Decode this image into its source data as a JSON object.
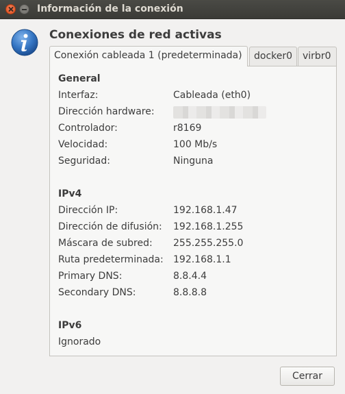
{
  "window": {
    "title": "Información de la conexión"
  },
  "heading": "Conexiones de red activas",
  "tabs": [
    {
      "label": "Conexión cableada 1 (predeterminada)"
    },
    {
      "label": "docker0"
    },
    {
      "label": "virbr0"
    }
  ],
  "general": {
    "title": "General",
    "rows": [
      {
        "label": "Interfaz:",
        "value": "Cableada (eth0)"
      },
      {
        "label": "Dirección hardware:",
        "value": ""
      },
      {
        "label": "Controlador:",
        "value": "r8169"
      },
      {
        "label": "Velocidad:",
        "value": "100 Mb/s"
      },
      {
        "label": "Seguridad:",
        "value": "Ninguna"
      }
    ]
  },
  "ipv4": {
    "title": "IPv4",
    "rows": [
      {
        "label": "Dirección IP:",
        "value": "192.168.1.47"
      },
      {
        "label": "Dirección de difusión:",
        "value": "192.168.1.255"
      },
      {
        "label": "Máscara de subred:",
        "value": "255.255.255.0"
      },
      {
        "label": "Ruta predeterminada:",
        "value": "192.168.1.1"
      },
      {
        "label": "Primary DNS:",
        "value": "8.8.4.4"
      },
      {
        "label": "Secondary DNS:",
        "value": "8.8.8.8"
      }
    ]
  },
  "ipv6": {
    "title": "IPv6",
    "status": "Ignorado"
  },
  "buttons": {
    "close_label": "Cerrar"
  },
  "colors": {
    "titlebar": "#3b3b37",
    "close_button": "#df4a16",
    "info_icon": "#2f6fb8",
    "background": "#f2f1f0"
  }
}
